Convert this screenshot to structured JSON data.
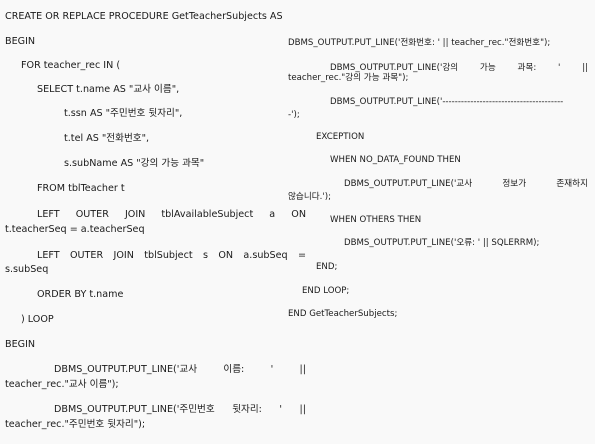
{
  "left": {
    "l1": "CREATE OR REPLACE PROCEDURE GetTeacherSubjects AS",
    "l2": "BEGIN",
    "l3": "FOR teacher_rec IN (",
    "l4": "SELECT t.name AS \"교사 이름\",",
    "l5": "t.ssn AS \"주민번호 뒷자리\",",
    "l6": "t.tel AS \"전화번호\",",
    "l7": "s.subName AS \"강의 가능 과목\"",
    "l8": "FROM tblTeacher t",
    "l9a": "LEFT OUTER JOIN tblAvailableSubject a ON",
    "l9b": "t.teacherSeq = a.teacherSeq",
    "l10a": "LEFT OUTER JOIN tblSubject s ON a.subSeq =",
    "l10b": "s.subSeq",
    "l11": "ORDER BY t.name",
    "l12": ") LOOP",
    "l13": "BEGIN",
    "l14a": "DBMS_OUTPUT.PUT_LINE('교사 이름: ' ||",
    "l14b": "teacher_rec.\"교사 이름\");",
    "l15a": "DBMS_OUTPUT.PUT_LINE('주민번호 뒷자리: ' ||",
    "l15b": "teacher_rec.\"주민번호 뒷자리\");"
  },
  "right": {
    "r1": "DBMS_OUTPUT.PUT_LINE('전화번호: ' || teacher_rec.\"전화번호\");",
    "r2a": "DBMS_OUTPUT.PUT_LINE('강의 가능 과목: ' ||",
    "r2b": "teacher_rec.\"강의 가능 과목\");",
    "r3a": "DBMS_OUTPUT.PUT_LINE('---------------------------------------",
    "r3b": "-');",
    "r4": "EXCEPTION",
    "r5": "WHEN NO_DATA_FOUND THEN",
    "r6a": "DBMS_OUTPUT.PUT_LINE('교사 정보가 존재하지",
    "r6b": "않습니다.');",
    "r7": "WHEN OTHERS THEN",
    "r8": "DBMS_OUTPUT.PUT_LINE('오류: ' || SQLERRM);",
    "r9": "END;",
    "r10": "END LOOP;",
    "r11": "END GetTeacherSubjects;"
  }
}
